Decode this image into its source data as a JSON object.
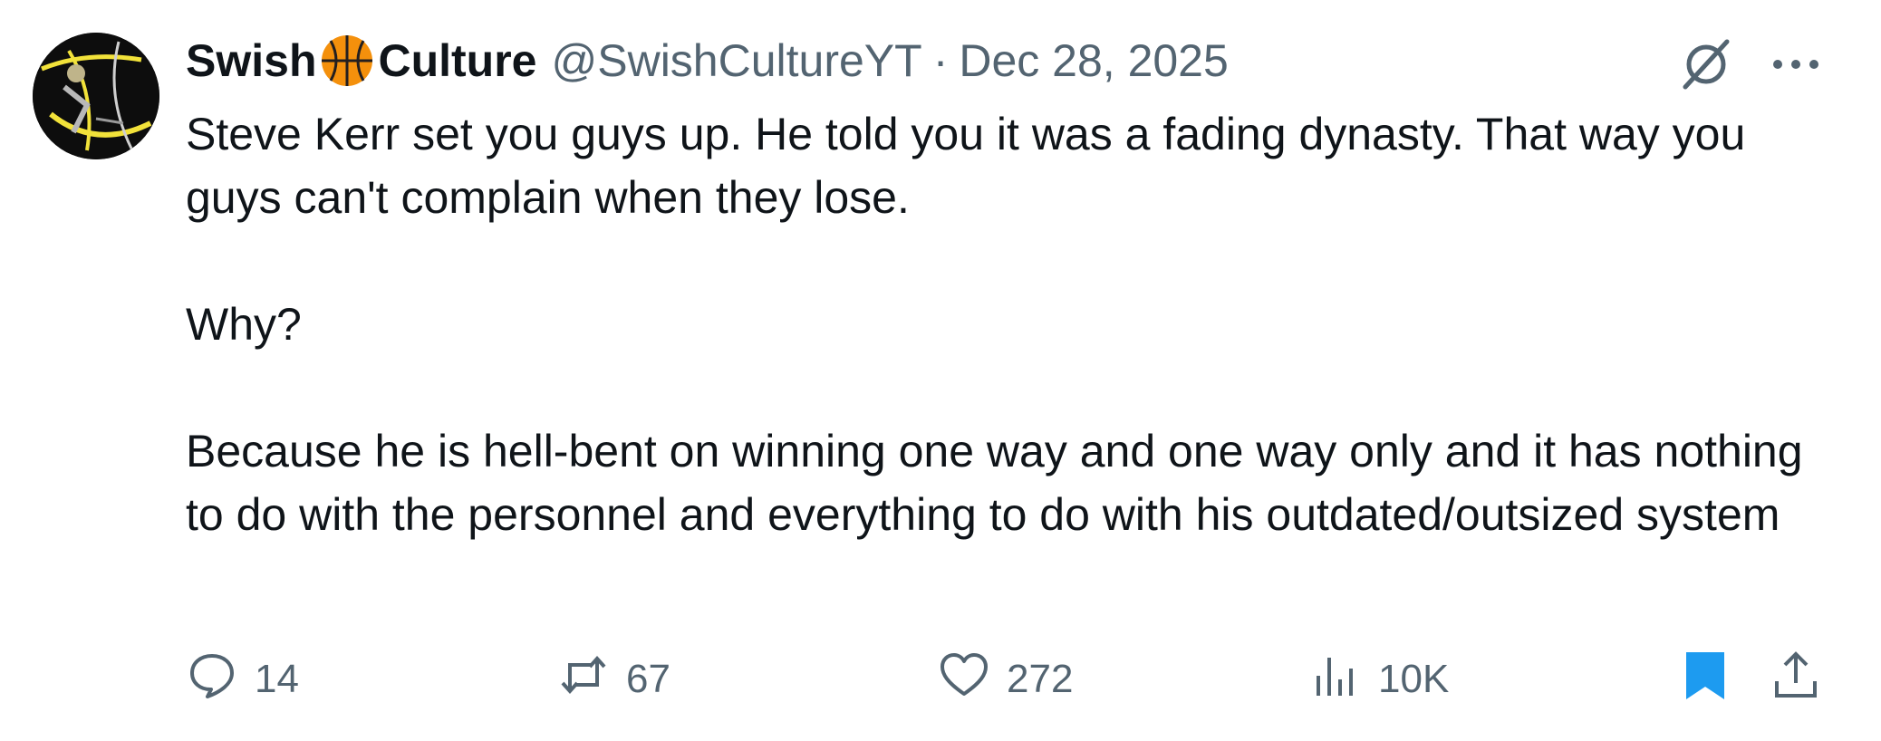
{
  "tweet": {
    "author": {
      "name_part1": "Swish",
      "name_part2": "Culture",
      "name_emoji_icon": "basketball-icon",
      "handle": "@SwishCultureYT"
    },
    "separator": "·",
    "date": "Dec 28, 2025",
    "paragraphs": [
      "Steve Kerr set you guys up. He told you it was a fading dynasty. That way you guys can't complain when they lose.",
      "Why?",
      "Because he is hell-bent on winning one way and one way only and it has nothing to do with the personnel and everything to do with his outdated/outsized system"
    ],
    "actions": {
      "replies": "14",
      "reposts": "67",
      "likes": "272",
      "views": "10K"
    },
    "bookmarked": true
  },
  "colors": {
    "text_primary": "#0f1419",
    "text_secondary": "#536471",
    "accent": "#1d9bf0",
    "basketball": "#f4900c"
  },
  "icons": {
    "top_right": [
      "grok-icon",
      "more-icon"
    ],
    "actions": [
      "reply-icon",
      "repost-icon",
      "like-icon",
      "views-icon",
      "bookmark-icon",
      "share-icon"
    ]
  }
}
